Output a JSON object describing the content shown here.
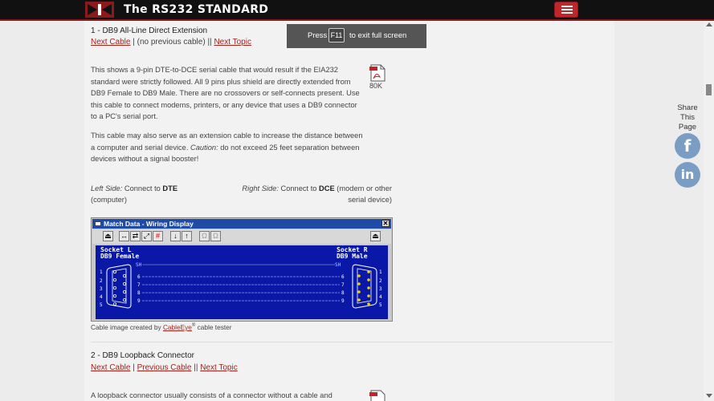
{
  "header": {
    "site_title": "The RS232 STANDARD",
    "menu_icon": "hamburger-icon"
  },
  "fullscreen_notice": {
    "prefix": "Press",
    "key": "F11",
    "suffix": "to exit full screen"
  },
  "section1": {
    "title": "1 - DB9 All-Line Direct Extension",
    "next_cable": "Next Cable",
    "sep1": " | ",
    "no_prev": "(no previous cable)",
    "sep2": " || ",
    "next_topic": "Next Topic",
    "pdf_size": "80K",
    "para1": "This shows a 9-pin DTE-to-DCE serial cable that would result if the EIA232 standard were strictly followed. All 9 pins plus shield are directly extended from DB9 Female to DB9 Male. There are no crossovers or self-connects present. Use this cable to connect modems, printers, or any device that uses a DB9 connector to a PC's serial port.",
    "para2_a": "This cable may also serve as an extension cable to increase the distance between a computer and serial device. ",
    "para2_caution": "Caution:",
    "para2_b": " do not exceed 25 feet separation between devices without a signal booster!",
    "left_label": "Left Side:",
    "left_text": " Connect to ",
    "left_bold": "DTE",
    "left_tail": " (computer)",
    "right_label": "Right Side:",
    "right_text": " Connect to ",
    "right_bold": "DCE",
    "right_tail": " (modem or other serial device)",
    "wiring": {
      "window_title": "Match Data - Wiring Display",
      "close": "✕",
      "socket_l": "Socket L",
      "socket_l_type": "DB9 Female",
      "socket_r": "Socket R",
      "socket_r_type": "DB9 Male",
      "shield": "SH"
    },
    "caption_a": "Cable image created by ",
    "caption_link": "CableEye",
    "caption_sup": "®",
    "caption_b": " cable tester"
  },
  "section2": {
    "title": "2 - DB9 Loopback Connector",
    "next_cable": "Next Cable",
    "sep1": " | ",
    "prev_cable": "Previous Cable",
    "sep2": " || ",
    "next_topic": "Next Topic",
    "para1": "A loopback connector usually consists of a connector without a cable and"
  },
  "share": {
    "label": "Share This Page",
    "facebook": "f",
    "linkedin": "in"
  },
  "colors": {
    "link": "#a3231d",
    "header_bg": "#111111",
    "wire_panel": "#0a18a8",
    "share_btn": "#7a9ec3"
  }
}
